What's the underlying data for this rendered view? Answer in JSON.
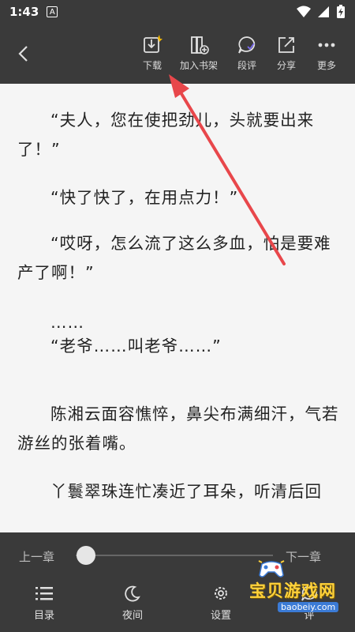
{
  "status_bar": {
    "time": "1:43",
    "app_badge": "A"
  },
  "toolbar": {
    "actions": [
      {
        "label": "下载",
        "icon": "download-icon"
      },
      {
        "label": "加入书架",
        "icon": "bookshelf-add-icon"
      },
      {
        "label": "段评",
        "icon": "comment-icon"
      },
      {
        "label": "分享",
        "icon": "share-icon"
      },
      {
        "label": "更多",
        "icon": "more-icon"
      }
    ]
  },
  "content": {
    "paragraphs": [
      "“夫人，您在使把劲儿，头就要出来了！”",
      "“快了快了，在用点力！”",
      "“哎呀，怎么流了这么多血，怕是要难产了啊！”",
      "……",
      "“老爷……叫老爷……”",
      "陈湘云面容憔悴，鼻尖布满细汗，气若游丝的张着嘴。",
      "丫鬟翠珠连忙凑近了耳朵，听清后回"
    ]
  },
  "bottom": {
    "prev_chapter": "上一章",
    "next_chapter": "下一章",
    "progress": 0.05,
    "items": [
      {
        "label": "目录",
        "icon": "menu-list-icon"
      },
      {
        "label": "夜间",
        "icon": "moon-icon"
      },
      {
        "label": "设置",
        "icon": "gear-icon"
      },
      {
        "label": "评",
        "icon": "comment-icon"
      }
    ]
  },
  "watermark": {
    "text": "宝贝游戏网",
    "url": "baobeiy.com"
  },
  "colors": {
    "bar_bg": "#3a3a3a",
    "page_bg": "#f5f5f5",
    "arrow": "#e8474b",
    "watermark_yellow": "#ffd23b"
  }
}
